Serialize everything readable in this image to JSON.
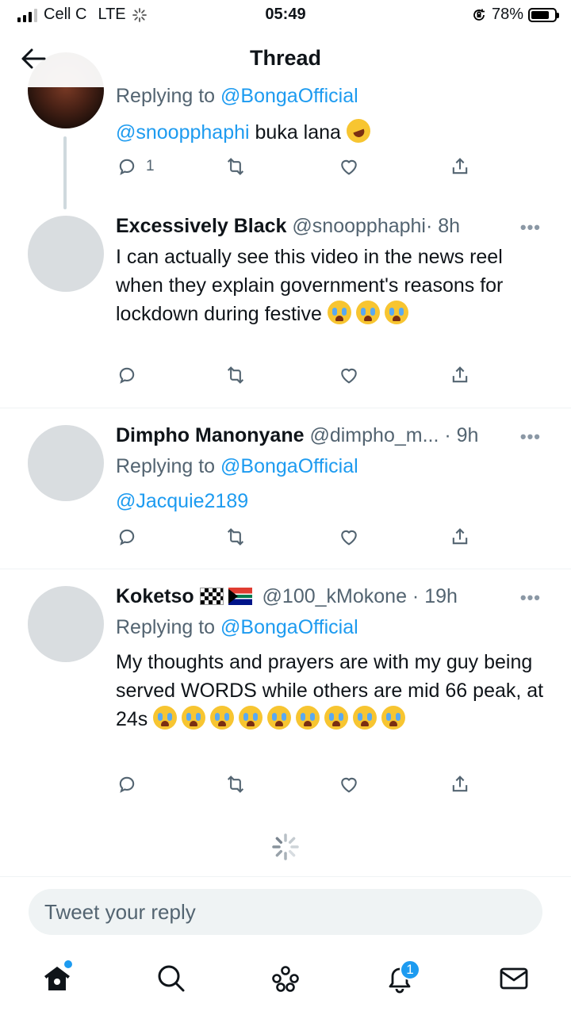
{
  "status_bar": {
    "carrier": "Cell C",
    "network": "LTE",
    "time": "05:49",
    "battery": "78%",
    "battery_level": 0.78
  },
  "header": {
    "title": "Thread",
    "back_icon": "arrow-left-icon"
  },
  "tweets": [
    {
      "replying_label": "Replying to ",
      "replying_to": "@BongaOfficial",
      "mention": "@snoopphaphi",
      "text": " buka lana ",
      "emojis": [
        "rolling-on-floor-laughing"
      ],
      "reply_count": "1"
    },
    {
      "name": "Excessively Black",
      "handle": "@snoopphaphi",
      "time": "· 8h",
      "more": "•••",
      "text": "I can actually see this video in the news reel when they explain government's reasons for lockdown during festive ",
      "emojis": [
        "crying",
        "crying",
        "crying"
      ]
    },
    {
      "name": "Dimpho Manonyane",
      "handle": "@dimpho_m...",
      "time": " · 9h",
      "more": "•••",
      "replying_label": "Replying to ",
      "replying_to": "@BongaOfficial",
      "mention": "@Jacquie2189"
    },
    {
      "name": "Koketso",
      "flags": [
        "chequered-flag",
        "south-africa-flag"
      ],
      "handle": "@100_kMokone",
      "time": " · 19h",
      "more": "•••",
      "replying_label": "Replying to ",
      "replying_to": "@BongaOfficial",
      "text": "My thoughts and prayers are with my guy being served WORDS while others are mid 66 peak, at 24s ",
      "emojis": [
        "crying",
        "crying",
        "crying",
        "crying",
        "crying",
        "crying",
        "crying",
        "crying",
        "crying"
      ]
    }
  ],
  "reply_bar": {
    "placeholder": "Tweet your reply"
  },
  "bottom_nav": {
    "items": [
      "home-icon",
      "search-icon",
      "spaces-icon",
      "notifications-icon",
      "messages-icon"
    ],
    "notifications_badge": "1"
  },
  "colors": {
    "link": "#1d9bf0",
    "text": "#0f1419",
    "muted": "#536471"
  }
}
